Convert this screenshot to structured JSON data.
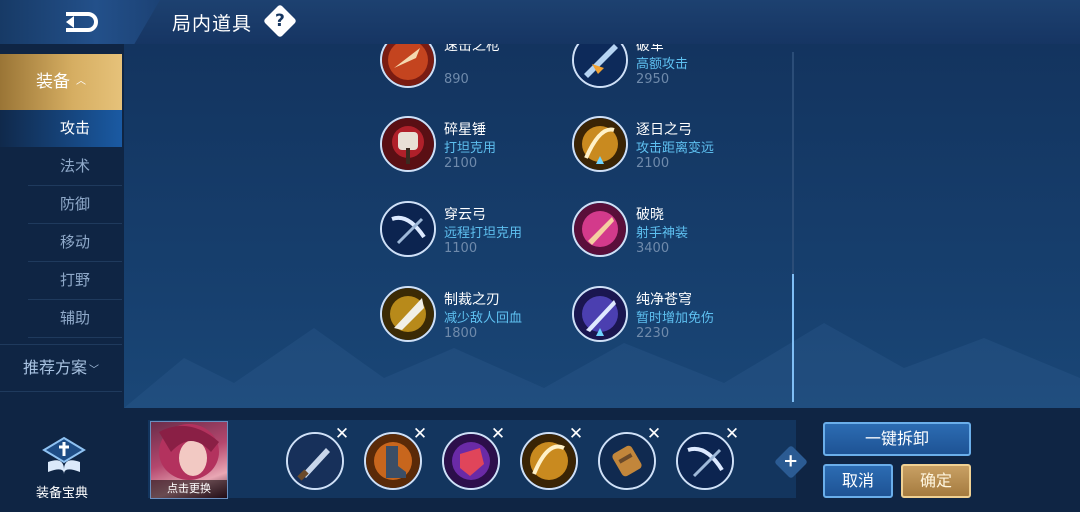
{
  "header": {
    "title": "局内道具",
    "help": "?"
  },
  "sidebar": {
    "category": "装备",
    "sub_items": [
      "攻击",
      "法术",
      "防御",
      "移动",
      "打野",
      "辅助"
    ],
    "active_sub": "攻击",
    "recommend": "推荐方案",
    "guide": "装备宝典"
  },
  "items": [
    {
      "name": "速击之枪",
      "desc": "",
      "price": "890",
      "icon": "spear-icon"
    },
    {
      "name": "破军",
      "desc": "高额攻击",
      "price": "2950",
      "icon": "sword-icon"
    },
    {
      "name": "碎星锤",
      "desc": "打坦克用",
      "price": "2100",
      "icon": "hammer-icon"
    },
    {
      "name": "逐日之弓",
      "desc": "攻击距离变远",
      "price": "2100",
      "icon": "bow-icon"
    },
    {
      "name": "穿云弓",
      "desc": "远程打坦克用",
      "price": "1100",
      "icon": "bow-icon"
    },
    {
      "name": "破晓",
      "desc": "射手神装",
      "price": "3400",
      "icon": "crossbow-icon"
    },
    {
      "name": "制裁之刃",
      "desc": "减少敌人回血",
      "price": "1800",
      "icon": "blade-icon"
    },
    {
      "name": "纯净苍穹",
      "desc": "暂时增加免伤",
      "price": "2230",
      "icon": "sword-icon"
    }
  ],
  "loadout": {
    "hero_label": "点击更换",
    "slots": [
      "dagger-icon",
      "boots-icon",
      "gauntlet-icon",
      "bow-icon",
      "bracer-icon",
      "bow-icon"
    ],
    "add": "+"
  },
  "actions": {
    "unequip_all": "一键拆卸",
    "cancel": "取消",
    "confirm": "确定"
  },
  "colors": {
    "accent_gold": "#d6ae62",
    "desc_blue": "#5ec0f0",
    "price_grey": "#6f8aab"
  }
}
